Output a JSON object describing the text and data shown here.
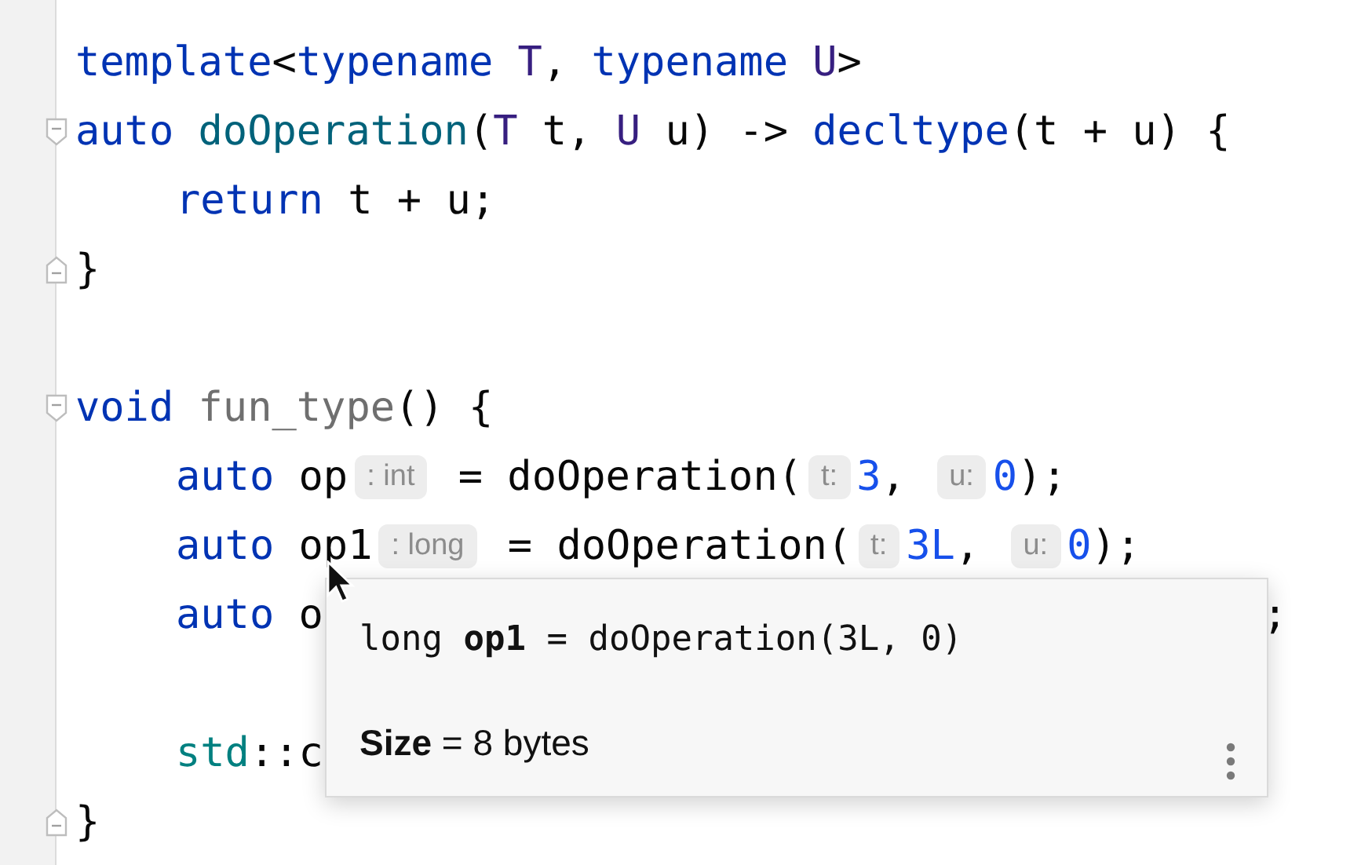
{
  "editor": {
    "lines": [
      {
        "kind": "code",
        "indented": false,
        "tokens": [
          {
            "kind": "kw",
            "text": "template"
          },
          {
            "kind": "plain",
            "text": "<"
          },
          {
            "kind": "kw",
            "text": "typename"
          },
          {
            "kind": "tparam",
            "text": " T"
          },
          {
            "kind": "plain",
            "text": ", "
          },
          {
            "kind": "kw",
            "text": "typename"
          },
          {
            "kind": "tparam",
            "text": " U"
          },
          {
            "kind": "plain",
            "text": ">"
          }
        ]
      },
      {
        "kind": "fold-start",
        "indented": false,
        "tokens": [
          {
            "kind": "kw",
            "text": "auto"
          },
          {
            "kind": "func",
            "text": " doOperation"
          },
          {
            "kind": "plain",
            "text": "("
          },
          {
            "kind": "tparam",
            "text": "T"
          },
          {
            "kind": "plain",
            "text": " t, "
          },
          {
            "kind": "tparam",
            "text": "U"
          },
          {
            "kind": "plain",
            "text": " u) -> "
          },
          {
            "kind": "kw",
            "text": "decltype"
          },
          {
            "kind": "plain",
            "text": "(t + u) {"
          }
        ]
      },
      {
        "kind": "code",
        "indented": true,
        "tokens": [
          {
            "kind": "kw",
            "text": "return"
          },
          {
            "kind": "plain",
            "text": " t + u;"
          }
        ]
      },
      {
        "kind": "fold-end",
        "indented": false,
        "tokens": [
          {
            "kind": "plain",
            "text": "}"
          }
        ]
      },
      {
        "kind": "blank"
      },
      {
        "kind": "fold-start",
        "indented": false,
        "tokens": [
          {
            "kind": "kw",
            "text": "void"
          },
          {
            "kind": "unused",
            "text": " fun_type"
          },
          {
            "kind": "plain",
            "text": "() {"
          }
        ]
      },
      {
        "kind": "code",
        "indented": true,
        "tokens": [
          {
            "kind": "kw",
            "text": "auto"
          },
          {
            "kind": "plain",
            "text": " op"
          },
          {
            "kind": "hint",
            "text": ": int"
          },
          {
            "kind": "plain",
            "text": " = doOperation("
          },
          {
            "kind": "hint",
            "text": "t:"
          },
          {
            "kind": "num",
            "text": "3"
          },
          {
            "kind": "plain",
            "text": ", "
          },
          {
            "kind": "hint",
            "text": "u:"
          },
          {
            "kind": "num",
            "text": "0"
          },
          {
            "kind": "plain",
            "text": ");"
          }
        ]
      },
      {
        "kind": "code",
        "indented": true,
        "tokens": [
          {
            "kind": "kw",
            "text": "auto"
          },
          {
            "kind": "plain",
            "text": " op1"
          },
          {
            "kind": "hint",
            "text": ": long"
          },
          {
            "kind": "plain",
            "text": " = doOperation("
          },
          {
            "kind": "hint",
            "text": "t:"
          },
          {
            "kind": "num",
            "text": "3L"
          },
          {
            "kind": "plain",
            "text": ", "
          },
          {
            "kind": "hint",
            "text": "u:"
          },
          {
            "kind": "num",
            "text": "0"
          },
          {
            "kind": "plain",
            "text": ");"
          }
        ]
      },
      {
        "kind": "code",
        "indented": true,
        "tokens": [
          {
            "kind": "kw",
            "text": "auto"
          },
          {
            "kind": "plain",
            "text": " o"
          }
        ],
        "tail": ";"
      },
      {
        "kind": "blank"
      },
      {
        "kind": "code",
        "indented": true,
        "tokens": [
          {
            "kind": "ns",
            "text": "std"
          },
          {
            "kind": "plain",
            "text": "::c"
          }
        ]
      },
      {
        "kind": "fold-end",
        "indented": false,
        "tokens": [
          {
            "kind": "plain",
            "text": "}"
          }
        ]
      }
    ]
  },
  "popup": {
    "signature": "long **op1** = doOperation(3L, 0)",
    "size": "**Size** = 8 bytes"
  }
}
